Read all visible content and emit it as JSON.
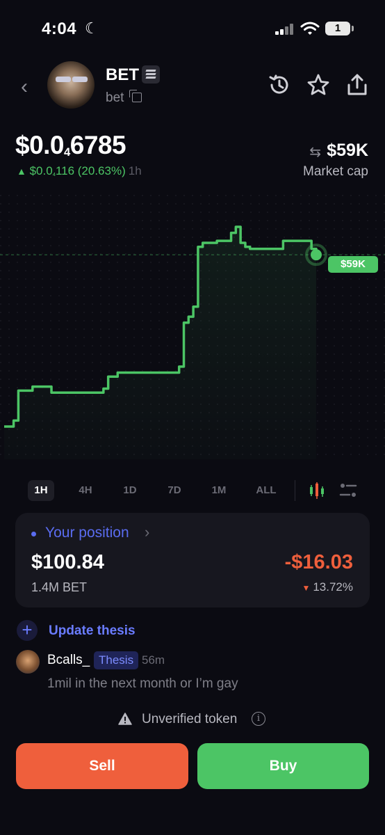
{
  "status_bar": {
    "time": "4:04",
    "battery": "1"
  },
  "token": {
    "ticker": "BET",
    "name": "bet",
    "price_prefix": "$0.0",
    "price_sub": "4",
    "price_rest": "6785",
    "change_prefix": "$0.0",
    "change_sub": "4",
    "change_rest": "116 (20.63%)",
    "change_period": "1h",
    "market_cap_value": "$59K",
    "market_cap_label": "Market cap"
  },
  "chart_data": {
    "type": "line",
    "current_label": "$59K",
    "line_color": "#4cc565",
    "points": [
      [
        0,
        0.0
      ],
      [
        1,
        0.0
      ],
      [
        2,
        0.03
      ],
      [
        3,
        0.18
      ],
      [
        4,
        0.18
      ],
      [
        5,
        0.18
      ],
      [
        6,
        0.2
      ],
      [
        7,
        0.2
      ],
      [
        8,
        0.2
      ],
      [
        9,
        0.2
      ],
      [
        10,
        0.17
      ],
      [
        11,
        0.17
      ],
      [
        12,
        0.17
      ],
      [
        13,
        0.17
      ],
      [
        14,
        0.17
      ],
      [
        15,
        0.17
      ],
      [
        16,
        0.17
      ],
      [
        17,
        0.17
      ],
      [
        18,
        0.17
      ],
      [
        19,
        0.17
      ],
      [
        20,
        0.17
      ],
      [
        21,
        0.19
      ],
      [
        22,
        0.25
      ],
      [
        23,
        0.25
      ],
      [
        24,
        0.27
      ],
      [
        25,
        0.27
      ],
      [
        26,
        0.27
      ],
      [
        27,
        0.27
      ],
      [
        28,
        0.27
      ],
      [
        29,
        0.27
      ],
      [
        30,
        0.27
      ],
      [
        31,
        0.27
      ],
      [
        32,
        0.27
      ],
      [
        33,
        0.27
      ],
      [
        34,
        0.27
      ],
      [
        35,
        0.27
      ],
      [
        36,
        0.27
      ],
      [
        37,
        0.3
      ],
      [
        38,
        0.52
      ],
      [
        39,
        0.55
      ],
      [
        40,
        0.6
      ],
      [
        41,
        0.9
      ],
      [
        42,
        0.92
      ],
      [
        43,
        0.92
      ],
      [
        44,
        0.92
      ],
      [
        45,
        0.93
      ],
      [
        46,
        0.93
      ],
      [
        47,
        0.93
      ],
      [
        48,
        0.97
      ],
      [
        49,
        1.0
      ],
      [
        50,
        0.92
      ],
      [
        51,
        0.9
      ],
      [
        52,
        0.89
      ],
      [
        53,
        0.89
      ],
      [
        54,
        0.89
      ],
      [
        55,
        0.89
      ],
      [
        56,
        0.89
      ],
      [
        57,
        0.89
      ],
      [
        58,
        0.89
      ],
      [
        59,
        0.93
      ],
      [
        60,
        0.93
      ],
      [
        61,
        0.93
      ],
      [
        62,
        0.93
      ],
      [
        63,
        0.93
      ],
      [
        64,
        0.93
      ],
      [
        65,
        0.89
      ],
      [
        66,
        0.86
      ]
    ]
  },
  "timeframes": [
    {
      "label": "1H",
      "active": true
    },
    {
      "label": "4H",
      "active": false
    },
    {
      "label": "1D",
      "active": false
    },
    {
      "label": "7D",
      "active": false
    },
    {
      "label": "1M",
      "active": false
    },
    {
      "label": "ALL",
      "active": false
    }
  ],
  "position": {
    "title": "Your position",
    "value": "$100.84",
    "amount": "1.4M BET",
    "pnl": "-$16.03",
    "pnl_pct": "13.72%"
  },
  "thesis": {
    "update_label": "Update thesis",
    "username": "Bcalls_",
    "tag": "Thesis",
    "time_ago": "56m",
    "message": "1mil in the next month or I’m gay"
  },
  "warning": {
    "text": "Unverified token"
  },
  "actions": {
    "sell_label": "Sell",
    "buy_label": "Buy"
  },
  "colors": {
    "green": "#4cc565",
    "red": "#ef5f3c",
    "accent": "#5a6cf0",
    "background": "#0b0b12"
  }
}
